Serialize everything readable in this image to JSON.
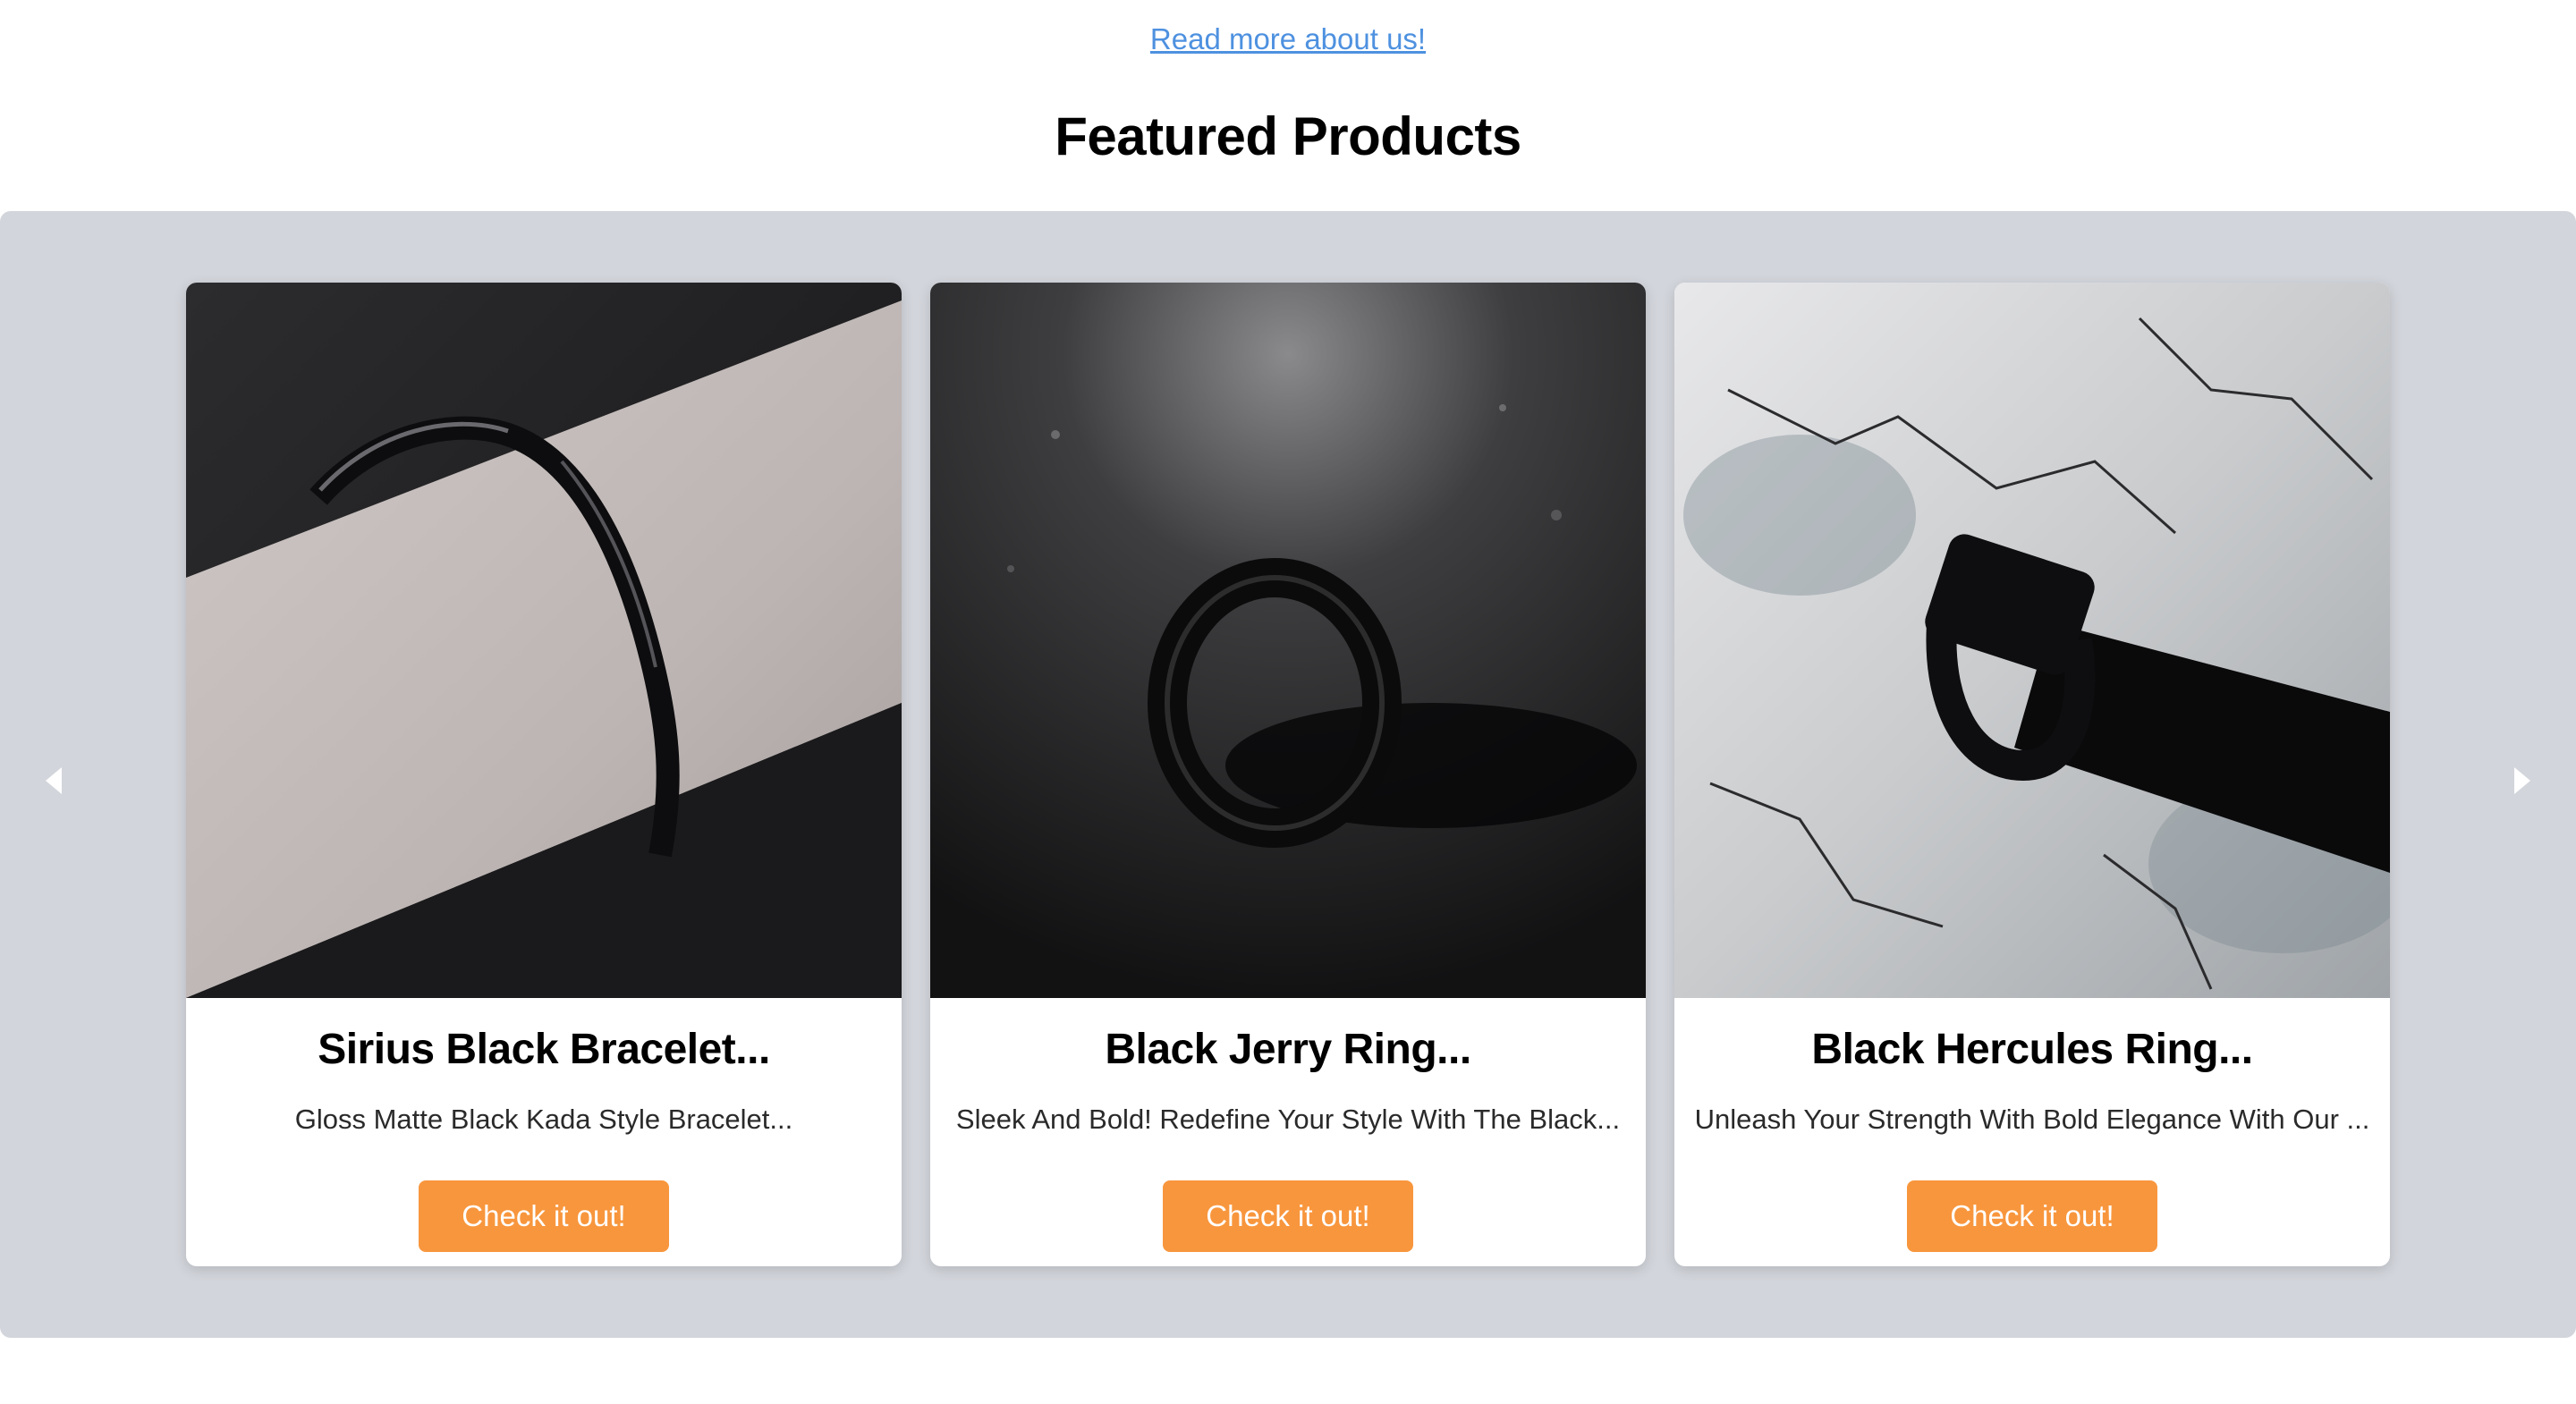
{
  "about": {
    "link_text": "Read more about us!"
  },
  "featured": {
    "title": "Featured Products",
    "products": [
      {
        "title": "Sirius Black Bracelet...",
        "description": "Gloss Matte Black Kada Style Bracelet...",
        "button": "Check it out!"
      },
      {
        "title": "Black Jerry Ring...",
        "description": "Sleek And Bold! Redefine Your Style With The Black...",
        "button": "Check it out!"
      },
      {
        "title": "Black Hercules Ring...",
        "description": "Unleash Your Strength With Bold Elegance With Our ...",
        "button": "Check it out!"
      }
    ]
  },
  "carousel": {
    "prev_icon": "chevron-left-icon",
    "next_icon": "chevron-right-icon"
  },
  "colors": {
    "link": "#4e91e0",
    "carousel_bg": "#d2d5db",
    "button": "#f8963d",
    "card_bg": "#ffffff"
  }
}
